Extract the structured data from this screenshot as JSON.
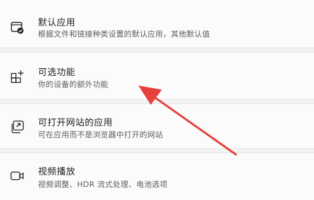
{
  "items": [
    {
      "icon": "default-apps-icon",
      "title": "默认应用",
      "subtitle": "根据文件和链接种类设置的默认应用，其他默认值"
    },
    {
      "icon": "optional-features-icon",
      "title": "可选功能",
      "subtitle": "你的设备的额外功能"
    },
    {
      "icon": "apps-for-websites-icon",
      "title": "可打开网站的应用",
      "subtitle": "可在应用而不是浏览器中打开的网站"
    },
    {
      "icon": "video-camera-icon",
      "title": "视频播放",
      "subtitle": "视频调整、HDR 流式处理、电池选项"
    }
  ],
  "annotation": {
    "arrow_color": "#e8413c"
  }
}
